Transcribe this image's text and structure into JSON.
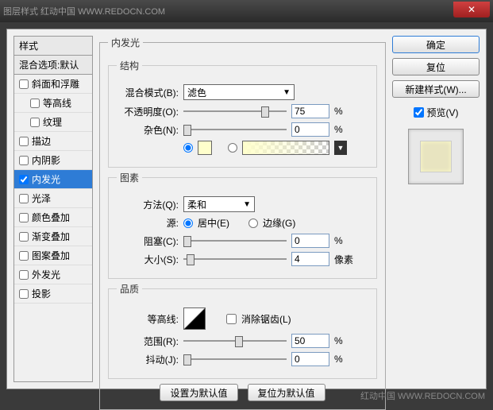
{
  "titlebar": {
    "text": "图层样式  红动中国 WWW.REDOCN.COM"
  },
  "styles": {
    "header": "样式",
    "blend": "混合选项:默认",
    "items": [
      {
        "label": "斜面和浮雕",
        "checked": false,
        "indent": false
      },
      {
        "label": "等高线",
        "checked": false,
        "indent": true
      },
      {
        "label": "纹理",
        "checked": false,
        "indent": true
      },
      {
        "label": "描边",
        "checked": false,
        "indent": false
      },
      {
        "label": "内阴影",
        "checked": false,
        "indent": false
      },
      {
        "label": "内发光",
        "checked": true,
        "selected": true,
        "indent": false
      },
      {
        "label": "光泽",
        "checked": false,
        "indent": false
      },
      {
        "label": "颜色叠加",
        "checked": false,
        "indent": false
      },
      {
        "label": "渐变叠加",
        "checked": false,
        "indent": false
      },
      {
        "label": "图案叠加",
        "checked": false,
        "indent": false
      },
      {
        "label": "外发光",
        "checked": false,
        "indent": false
      },
      {
        "label": "投影",
        "checked": false,
        "indent": false
      }
    ]
  },
  "panel": {
    "title": "内发光",
    "structure": {
      "legend": "结构",
      "blendMode": {
        "label": "混合模式(B):",
        "value": "滤色"
      },
      "opacity": {
        "label": "不透明度(O):",
        "value": "75",
        "unit": "%",
        "pos": 75
      },
      "noise": {
        "label": "杂色(N):",
        "value": "0",
        "unit": "%",
        "pos": 0
      }
    },
    "elements": {
      "legend": "图素",
      "technique": {
        "label": "方法(Q):",
        "value": "柔和"
      },
      "source": {
        "label": "源:",
        "center": "居中(E)",
        "edge": "边缘(G)"
      },
      "choke": {
        "label": "阻塞(C):",
        "value": "0",
        "unit": "%",
        "pos": 0
      },
      "size": {
        "label": "大小(S):",
        "value": "4",
        "unit": "像素",
        "pos": 3
      }
    },
    "quality": {
      "legend": "品质",
      "contour": {
        "label": "等高线:",
        "antialias": "消除锯齿(L)"
      },
      "range": {
        "label": "范围(R):",
        "value": "50",
        "unit": "%",
        "pos": 50
      },
      "jitter": {
        "label": "抖动(J):",
        "value": "0",
        "unit": "%",
        "pos": 0
      }
    },
    "buttons": {
      "default": "设置为默认值",
      "reset": "复位为默认值"
    }
  },
  "right": {
    "ok": "确定",
    "cancel": "复位",
    "newStyle": "新建样式(W)...",
    "preview": "预览(V)"
  },
  "footer": "红动中国 WWW.REDOCN.COM"
}
